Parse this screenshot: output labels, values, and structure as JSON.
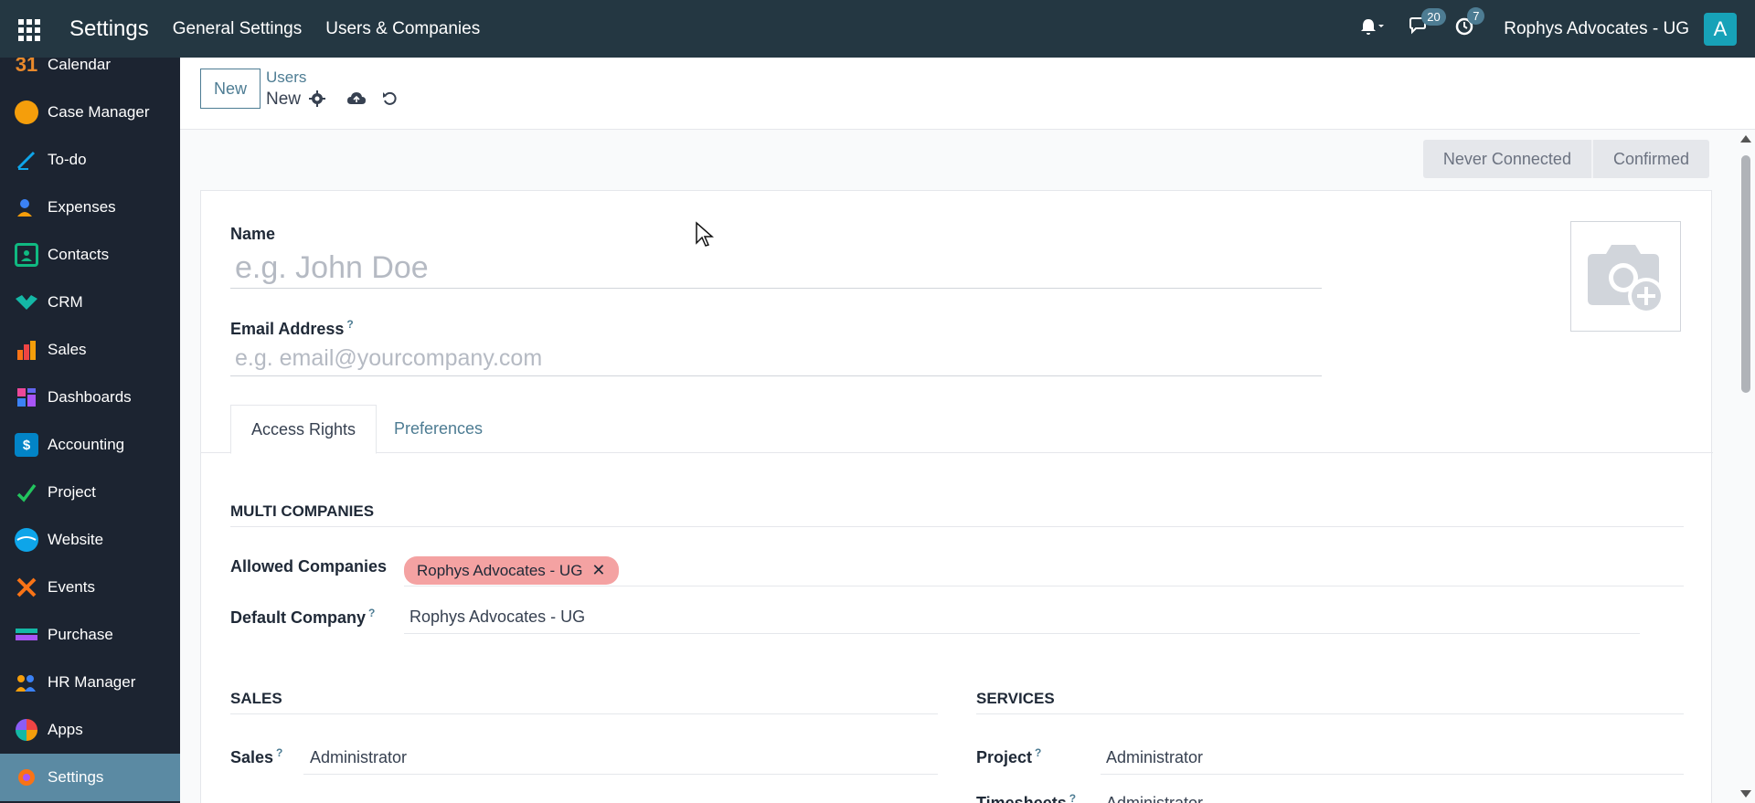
{
  "topbar": {
    "brand": "Settings",
    "menu": [
      "General Settings",
      "Users & Companies"
    ],
    "messages_count": "20",
    "activities_count": "7",
    "company": "Rophys Advocates - UG",
    "avatar_letter": "A"
  },
  "sidebar": {
    "items": [
      {
        "label": "Calendar",
        "icon": "calendar-icon",
        "color": "#c2410c"
      },
      {
        "label": "Case Manager",
        "icon": "case-manager-icon",
        "color": "#f59e0b"
      },
      {
        "label": "To-do",
        "icon": "todo-icon",
        "color": "#0ea5e9"
      },
      {
        "label": "Expenses",
        "icon": "expenses-icon",
        "color": "#3b82f6"
      },
      {
        "label": "Contacts",
        "icon": "contacts-icon",
        "color": "#10b981"
      },
      {
        "label": "CRM",
        "icon": "crm-icon",
        "color": "#14b8a6"
      },
      {
        "label": "Sales",
        "icon": "sales-icon",
        "color": "#f97316"
      },
      {
        "label": "Dashboards",
        "icon": "dashboards-icon",
        "color": "#ec4899"
      },
      {
        "label": "Accounting",
        "icon": "accounting-icon",
        "color": "#0284c7"
      },
      {
        "label": "Project",
        "icon": "project-icon",
        "color": "#22c55e"
      },
      {
        "label": "Website",
        "icon": "website-icon",
        "color": "#0ea5e9"
      },
      {
        "label": "Events",
        "icon": "events-icon",
        "color": "#f97316"
      },
      {
        "label": "Purchase",
        "icon": "purchase-icon",
        "color": "#14b8a6"
      },
      {
        "label": "HR Manager",
        "icon": "hr-manager-icon",
        "color": "#f59e0b"
      },
      {
        "label": "Apps",
        "icon": "apps-icon",
        "color": "#ef4444"
      },
      {
        "label": "Settings",
        "icon": "settings-icon",
        "color": "#f97316"
      }
    ],
    "active": "Settings"
  },
  "control": {
    "new_label": "New",
    "breadcrumb_parent": "Users",
    "breadcrumb_current": "New"
  },
  "status": {
    "stages": [
      "Never Connected",
      "Confirmed"
    ]
  },
  "form": {
    "name_label": "Name",
    "name_placeholder": "e.g. John Doe",
    "email_label": "Email Address",
    "email_placeholder": "e.g. email@yourcompany.com",
    "help_mark": "?",
    "tabs": [
      "Access Rights",
      "Preferences"
    ],
    "multi_companies_title": "MULTI COMPANIES",
    "allowed_companies_label": "Allowed Companies",
    "allowed_company_tag": "Rophys Advocates - UG",
    "default_company_label": "Default Company",
    "default_company_value": "Rophys Advocates - UG",
    "sales_section": "SALES",
    "sales_label": "Sales",
    "sales_value": "Administrator",
    "services_section": "SERVICES",
    "project_label": "Project",
    "project_value": "Administrator",
    "timesheets_label": "Timesheets",
    "timesheets_value": "Administrator"
  }
}
